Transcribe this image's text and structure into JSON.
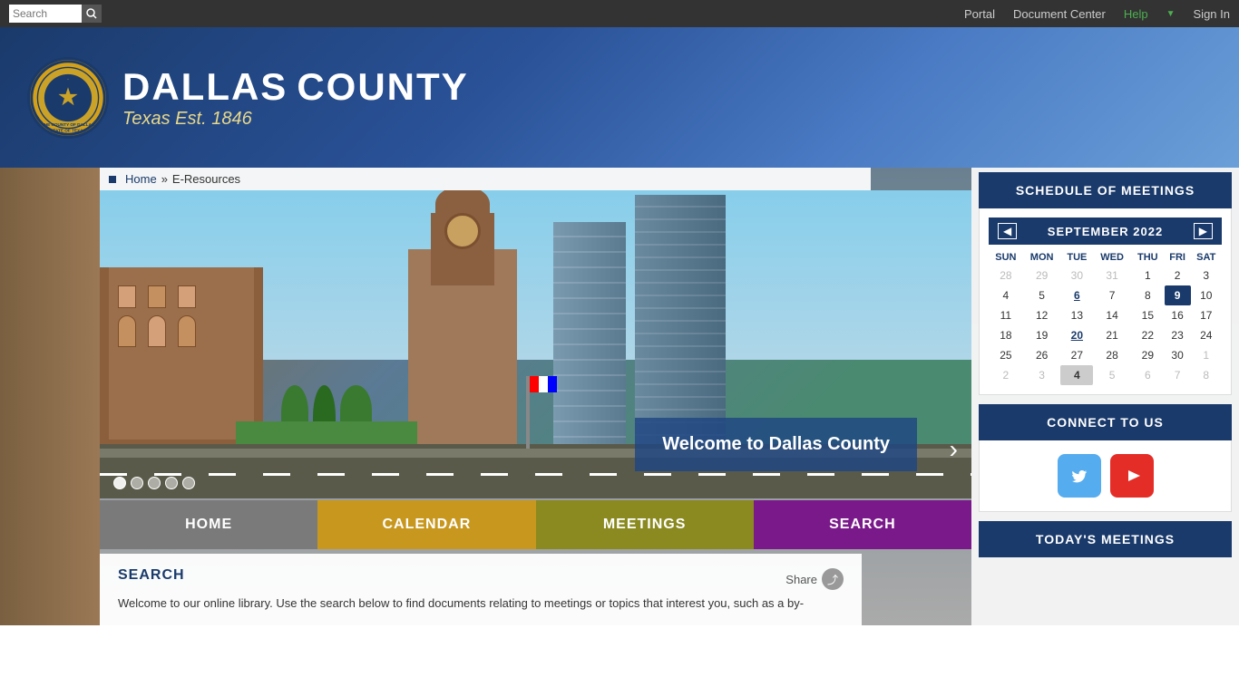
{
  "topbar": {
    "search_placeholder": "Search",
    "search_label": "Search",
    "nav_items": [
      {
        "label": "Portal",
        "id": "portal"
      },
      {
        "label": "Document Center",
        "id": "doc-center"
      },
      {
        "label": "Help",
        "id": "help"
      },
      {
        "label": "Sign In",
        "id": "signin"
      }
    ]
  },
  "header": {
    "title_line1": "DALLAS",
    "title_line2": "COUNTY",
    "subtitle": "Texas   Est. 1846",
    "seal_text": "THE COUNTY OF DALLAS STATE OF TEXAS"
  },
  "breadcrumb": {
    "home": "Home",
    "separator": "»",
    "current": "E-Resources"
  },
  "slideshow": {
    "caption": "Welcome to Dallas County",
    "dots": 5,
    "active_dot": 0
  },
  "nav_buttons": [
    {
      "id": "home",
      "label": "HOME",
      "color": "#7a7a7a"
    },
    {
      "id": "calendar",
      "label": "CALENDAR",
      "color": "#c8971e"
    },
    {
      "id": "meetings",
      "label": "MEETINGS",
      "color": "#8a8a20"
    },
    {
      "id": "search",
      "label": "SEARCH",
      "color": "#7a1a8a"
    }
  ],
  "search_section": {
    "title": "SEARCH",
    "share_label": "Share",
    "description": "Welcome to our online library. Use the search below to find documents relating to meetings or topics that interest you, such as a by-"
  },
  "schedule": {
    "header": "SCHEDULE OF MEETINGS",
    "month": "SEPTEMBER 2022",
    "days": [
      "SUN",
      "MON",
      "TUE",
      "WED",
      "THU",
      "FRI",
      "SAT"
    ],
    "weeks": [
      [
        {
          "n": "28",
          "type": "other"
        },
        {
          "n": "29",
          "type": "other"
        },
        {
          "n": "30",
          "type": "other"
        },
        {
          "n": "31",
          "type": "other"
        },
        {
          "n": "1",
          "type": "normal"
        },
        {
          "n": "2",
          "type": "normal"
        },
        {
          "n": "3",
          "type": "normal"
        }
      ],
      [
        {
          "n": "4",
          "type": "normal"
        },
        {
          "n": "5",
          "type": "normal"
        },
        {
          "n": "6",
          "type": "event-link"
        },
        {
          "n": "7",
          "type": "normal"
        },
        {
          "n": "8",
          "type": "normal"
        },
        {
          "n": "9",
          "type": "today"
        },
        {
          "n": "10",
          "type": "normal"
        }
      ],
      [
        {
          "n": "11",
          "type": "normal"
        },
        {
          "n": "12",
          "type": "normal"
        },
        {
          "n": "13",
          "type": "normal"
        },
        {
          "n": "14",
          "type": "normal"
        },
        {
          "n": "15",
          "type": "normal"
        },
        {
          "n": "16",
          "type": "normal"
        },
        {
          "n": "17",
          "type": "normal"
        }
      ],
      [
        {
          "n": "18",
          "type": "normal"
        },
        {
          "n": "19",
          "type": "normal"
        },
        {
          "n": "20",
          "type": "event-link"
        },
        {
          "n": "21",
          "type": "normal"
        },
        {
          "n": "22",
          "type": "normal"
        },
        {
          "n": "23",
          "type": "normal"
        },
        {
          "n": "24",
          "type": "normal"
        }
      ],
      [
        {
          "n": "25",
          "type": "normal"
        },
        {
          "n": "26",
          "type": "normal"
        },
        {
          "n": "27",
          "type": "normal"
        },
        {
          "n": "28",
          "type": "normal"
        },
        {
          "n": "29",
          "type": "normal"
        },
        {
          "n": "30",
          "type": "normal"
        },
        {
          "n": "1",
          "type": "other"
        }
      ],
      [
        {
          "n": "2",
          "type": "other"
        },
        {
          "n": "3",
          "type": "other"
        },
        {
          "n": "4",
          "type": "event-box"
        },
        {
          "n": "5",
          "type": "other"
        },
        {
          "n": "6",
          "type": "other"
        },
        {
          "n": "7",
          "type": "other"
        },
        {
          "n": "8",
          "type": "other"
        }
      ]
    ]
  },
  "connect": {
    "header": "CONNECT TO US",
    "twitter_label": "Twitter",
    "youtube_label": "YouTube"
  },
  "today_meetings": {
    "header": "TODAY'S MEETINGS"
  },
  "colors": {
    "primary_dark": "#1a3a6b",
    "primary_mid": "#2a5298",
    "gold": "#c8971e",
    "olive": "#8a8a20",
    "purple": "#7a1a8a",
    "gray_nav": "#7a7a7a"
  }
}
